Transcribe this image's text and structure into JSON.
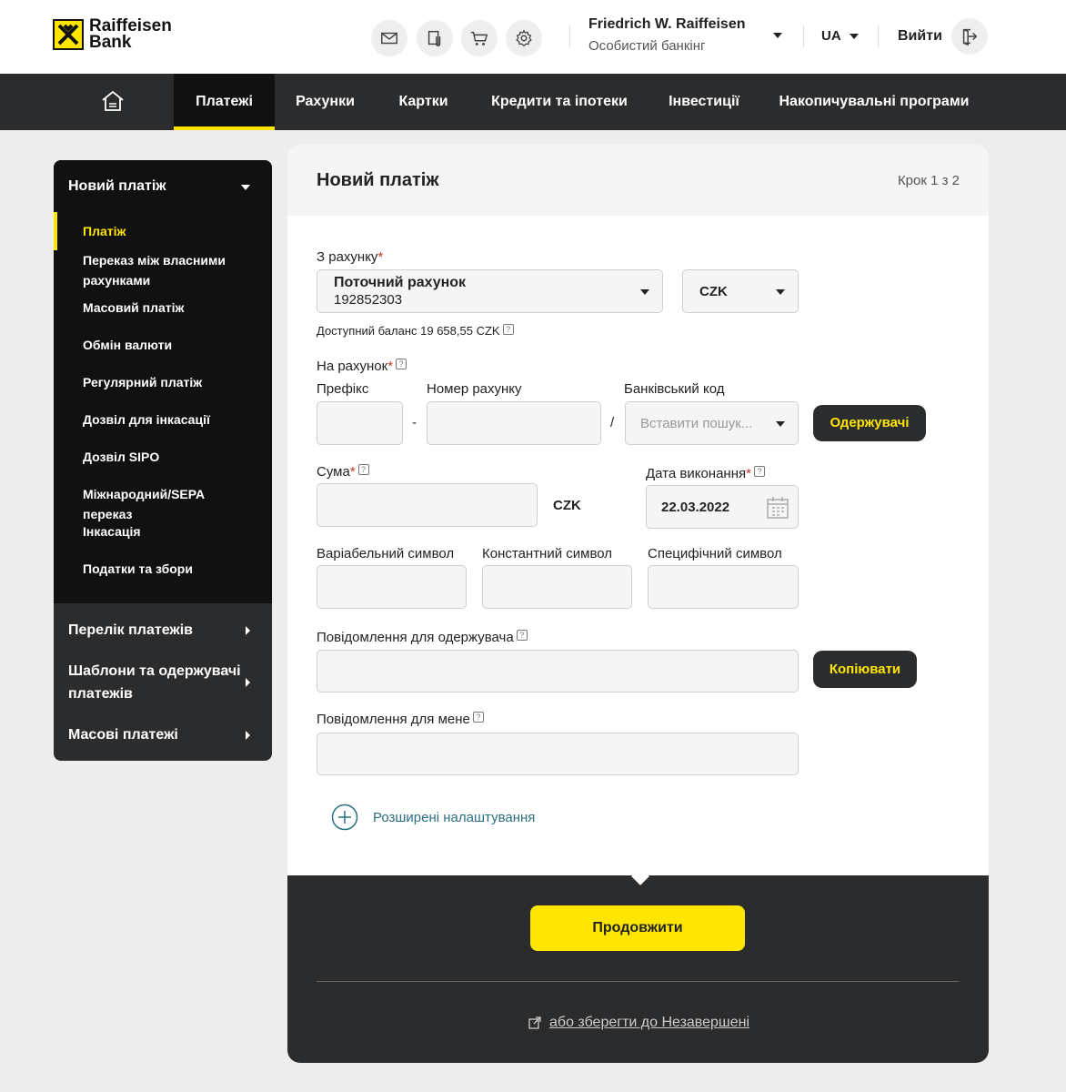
{
  "header": {
    "logo_line1": "Raiffeisen",
    "logo_line2": "Bank",
    "user_name": "Friedrich W. Raiffeisen",
    "user_subtitle": "Особистий банкінг",
    "language": "UA",
    "logout_label": "Вийти",
    "icons": [
      "mail-icon",
      "documents-icon",
      "cart-icon",
      "gear-icon"
    ]
  },
  "nav": {
    "items": [
      "Платежі",
      "Рахунки",
      "Картки",
      "Кредити та іпотеки",
      "Інвестиції",
      "Накопичувальні програми"
    ],
    "active": "Платежі"
  },
  "sidebar": {
    "section_title": "Новий платіж",
    "sub_items": [
      "Платіж",
      "Переказ між власними рахунками",
      "Масовий платіж",
      "Обмін валюти",
      "Регулярний платіж",
      "Дозвіл для інкасації",
      "Дозвіл SIPO",
      "Міжнародний/SEPA переказ",
      "Інкасація",
      "Податки та збори"
    ],
    "main_items": [
      "Перелік платежів",
      "Шаблони та одержувачі платежів",
      "Масові платежі"
    ]
  },
  "form": {
    "title": "Новий платіж",
    "step": "Крок 1 з 2",
    "from_account_label": "З рахунку",
    "account_name": "Поточний рахунок",
    "account_number": "192852303",
    "currency": "CZK",
    "balance_text": "Доступний баланс  19 658,55 CZK",
    "to_account_label": "На рахунок",
    "prefix_label": "Префікс",
    "number_label": "Номер рахунку",
    "bank_code_label": "Банківський код",
    "bank_code_placeholder": "Вставити пошук...",
    "dash": "-",
    "slash": "/",
    "recipients_button": "Одержувачі",
    "amount_label": "Сума",
    "amount_currency": "CZK",
    "date_label": "Дата виконання",
    "date_value": "22.03.2022",
    "variable_symbol_label": "Варіабельний символ",
    "constant_symbol_label": "Константний символ",
    "specific_symbol_label": "Специфічний символ",
    "message_recipient_label": "Повідомлення для одержувача",
    "copy_button": "Копіювати",
    "message_me_label": "Повідомлення для мене",
    "advanced_label": "Розширені налаштування",
    "continue_button": "Продовжити",
    "save_draft_link": "або зберегти до Незавершені",
    "required_mark": "*",
    "help_mark": "?"
  }
}
